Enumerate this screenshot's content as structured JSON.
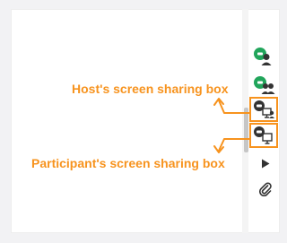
{
  "annotations": {
    "host_label": "Host's screen sharing box",
    "participant_label": "Participant's screen sharing box"
  },
  "toolbar": {
    "icons": [
      "host-user-icon",
      "participants-icon",
      "host-screen-share-icon",
      "participant-screen-share-icon",
      "play-icon",
      "paperclip-icon"
    ]
  },
  "colors": {
    "accent_orange": "#f7931e",
    "brand_green": "#21a55b",
    "icon_dark": "#333333"
  }
}
